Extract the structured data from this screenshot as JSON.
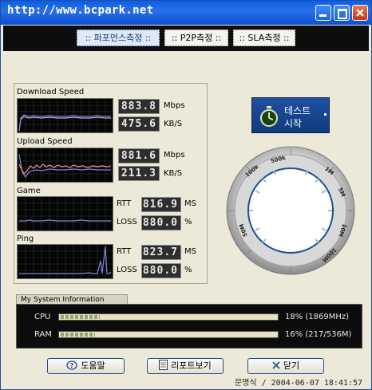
{
  "window": {
    "title": "http://www.bcpark.net",
    "min_icon": "minimize-icon",
    "max_icon": "maximize-icon",
    "close_icon": "close-icon"
  },
  "tabs": [
    {
      "label": ":: 퍼포먼스측정 ::",
      "active": true
    },
    {
      "label": ":: P2P측정 ::",
      "active": false
    },
    {
      "label": ":: SLA측정 ::",
      "active": false
    }
  ],
  "sections": {
    "download": {
      "label": "Download Speed",
      "mbps": "883.8",
      "mbps_unit": "Mbps",
      "kbs": "475.6",
      "kbs_unit": "KB/S"
    },
    "upload": {
      "label": "Upload Speed",
      "mbps": "881.6",
      "mbps_unit": "Mbps",
      "kbs": "211.3",
      "kbs_unit": "KB/S"
    },
    "game": {
      "label": "Game",
      "rtt_label": "RTT",
      "rtt": "816.9",
      "rtt_unit": "MS",
      "loss_label": "LOSS",
      "loss": "880.0",
      "loss_unit": "%"
    },
    "ping": {
      "label": "Ping",
      "rtt_label": "RTT",
      "rtt": "823.7",
      "rtt_unit": "MS",
      "loss_label": "LOSS",
      "loss": "880.0",
      "loss_unit": "%"
    }
  },
  "start_button": {
    "line1": "테스트",
    "line2": "시작",
    "icon": "stopwatch-icon"
  },
  "gauge": {
    "labels": [
      "100k",
      "500k",
      "1M",
      "5M",
      "10M",
      "50M",
      "100M"
    ]
  },
  "sysinfo": {
    "title": "My System Information",
    "cpu_label": "CPU",
    "cpu_value": "18% (1869MHz)",
    "cpu_fraction": 0.18,
    "ram_label": "RAM",
    "ram_value": "16% (217/536M)",
    "ram_fraction": 0.16
  },
  "buttons": {
    "help": "도움말",
    "help_icon": "help-icon",
    "report": "리포트보기",
    "report_icon": "report-icon",
    "close": "닫기",
    "close_icon": "x-icon"
  },
  "status": "문명식 / 2004-06-07 18:41:57"
}
